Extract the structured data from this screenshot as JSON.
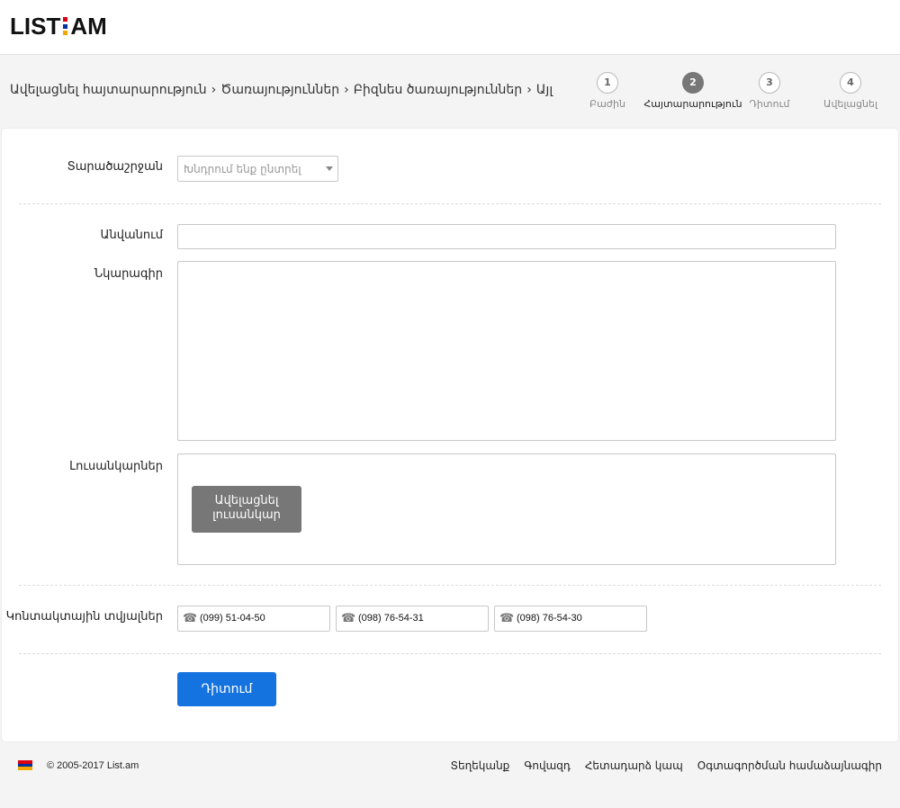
{
  "logo": {
    "left_text": "LIST",
    "right_text": "AM",
    "dot_colors": [
      "#d90012",
      "#0033a0",
      "#f2a800"
    ]
  },
  "breadcrumb": [
    "Ավելացնել հայտարարություն",
    "Ծառայություններ",
    "Բիզնես ծառայություններ",
    "Այլ"
  ],
  "breadcrumb_separator": "›",
  "steps": [
    {
      "number": "1",
      "label": "Բաժին"
    },
    {
      "number": "2",
      "label": "Հայտարարություն",
      "active": true
    },
    {
      "number": "3",
      "label": "Դիտում"
    },
    {
      "number": "4",
      "label": "Ավելացնել"
    }
  ],
  "form": {
    "region_label": "Տարածաշրջան",
    "region_placeholder": "Խնդրում ենք ընտրել",
    "title_label": "Անվանում",
    "title_value": "",
    "description_label": "Նկարագիր",
    "description_value": "",
    "photos_label": "Լուսանկարներ",
    "add_photo_button": "Ավելացնել լուսանկար",
    "contacts_label": "Կոնտակտային տվյալներ",
    "phones": [
      "(099) 51-04-50",
      "(098) 76-54-31",
      "(098) 76-54-30"
    ],
    "preview_button": "Դիտում"
  },
  "footer": {
    "flag_colors": [
      "#d90012",
      "#0033a0",
      "#f2a800"
    ],
    "copyright": "© 2005-2017 List.am",
    "links": [
      "Տեղեկանք",
      "Գովազդ",
      "Հետադարձ կապ",
      "Օգտագործման համաձայնագիր"
    ]
  },
  "colors": {
    "primary_button": "#1573e0",
    "secondary_button": "#777777"
  }
}
